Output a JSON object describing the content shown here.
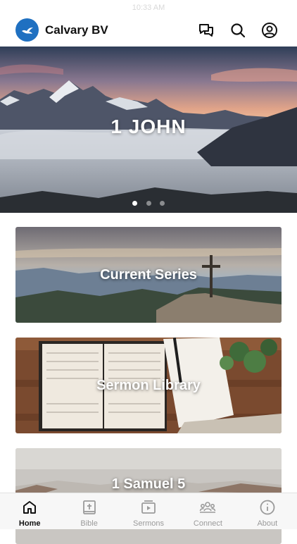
{
  "status_bar": {
    "time": "10:33 AM"
  },
  "header": {
    "app_title": "Calvary BV",
    "logo_icon": "dove-icon",
    "actions": [
      {
        "name": "messages",
        "icon": "chat-bubbles-icon"
      },
      {
        "name": "search",
        "icon": "search-icon"
      },
      {
        "name": "profile",
        "icon": "user-circle-icon"
      }
    ]
  },
  "hero": {
    "title": "1 JOHN",
    "slide_count": 3,
    "active_slide": 1
  },
  "cards": [
    {
      "label": "Current Series"
    },
    {
      "label": "Sermon Library"
    },
    {
      "label": "1 Samuel 5"
    }
  ],
  "tab_bar": {
    "tabs": [
      {
        "label": "Home",
        "icon": "home-icon",
        "active": true
      },
      {
        "label": "Bible",
        "icon": "bible-icon",
        "active": false
      },
      {
        "label": "Sermons",
        "icon": "video-play-icon",
        "active": false
      },
      {
        "label": "Connect",
        "icon": "group-icon",
        "active": false
      },
      {
        "label": "About",
        "icon": "info-icon",
        "active": false
      }
    ]
  },
  "colors": {
    "brand": "#1f70c1",
    "tab_active": "#111111",
    "tab_inactive": "#9a9a9a"
  }
}
